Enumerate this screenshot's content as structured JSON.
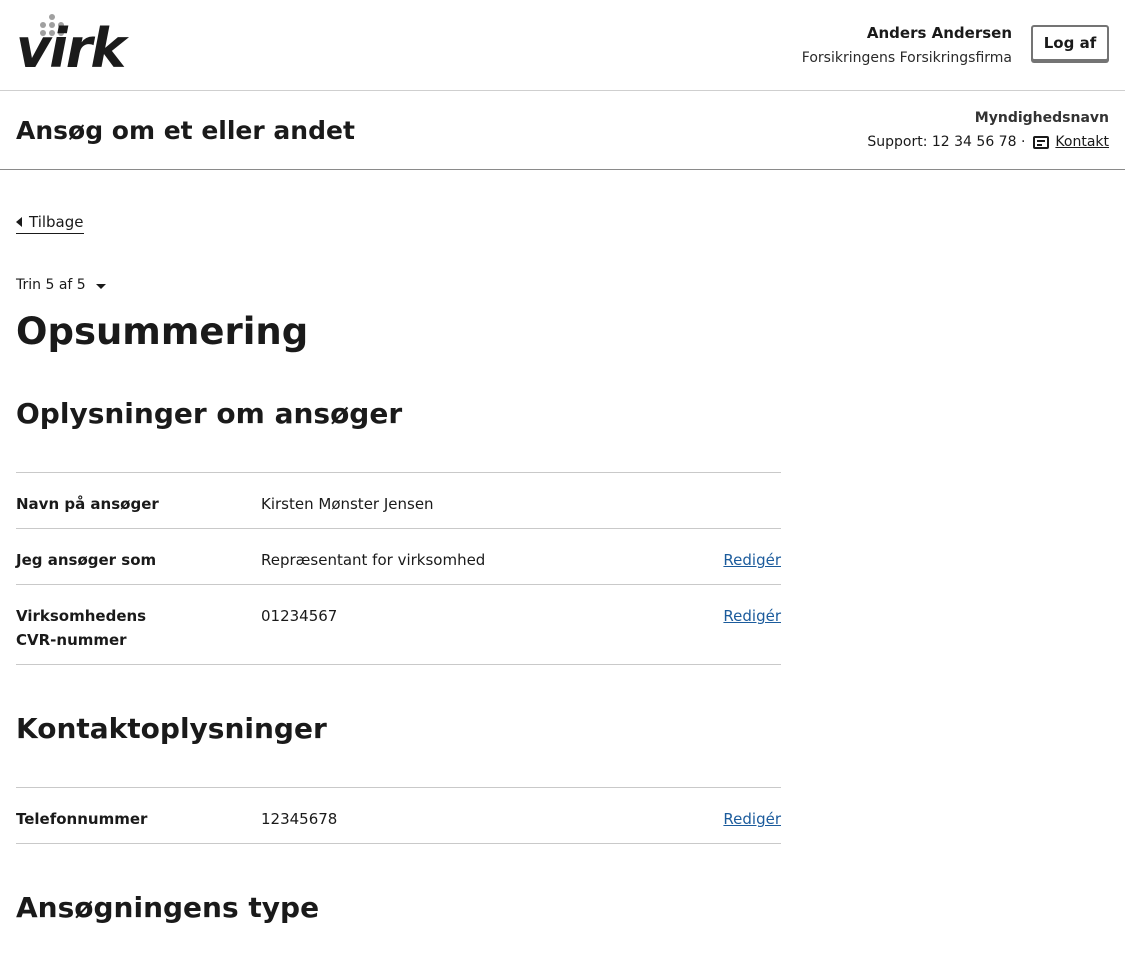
{
  "header": {
    "logo_text": "virk",
    "user_name": "Anders Andersen",
    "company": "Forsikringens Forsikringsfirma",
    "logout_label": "Log af"
  },
  "subheader": {
    "service_title": "Ansøg om et eller andet",
    "authority_name": "Myndighedsnavn",
    "support_text": "Support: 12 34 56 78 ·",
    "contact_label": "Kontakt"
  },
  "main": {
    "back_label": "Tilbage",
    "step_label": "Trin 5 af 5",
    "page_title": "Opsummering",
    "sections": [
      {
        "title": "Oplysninger om ansøger",
        "rows": [
          {
            "label": "Navn på ansøger",
            "value": "Kirsten Mønster Jensen",
            "edit": ""
          },
          {
            "label": "Jeg ansøger som",
            "value": "Repræsentant for virksomhed",
            "edit": "Redigér"
          },
          {
            "label": "Virksomhedens CVR-nummer",
            "value": "01234567",
            "edit": "Redigér"
          }
        ]
      },
      {
        "title": "Kontaktoplysninger",
        "rows": [
          {
            "label": "Telefonnummer",
            "value": "12345678",
            "edit": "Redigér"
          }
        ]
      },
      {
        "title": "Ansøgningens type",
        "rows": []
      }
    ]
  },
  "colors": {
    "link": "#1b5b9c",
    "border": "#c9c9c9",
    "text": "#1a1a1a"
  }
}
